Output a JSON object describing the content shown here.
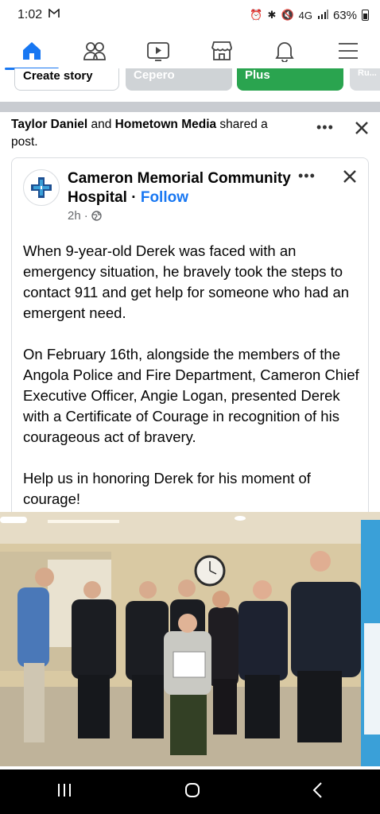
{
  "status_bar": {
    "time": "1:02",
    "left_icon": "gmail-m-icon",
    "network": "4G",
    "battery_pct": "63%"
  },
  "nav": {
    "items": [
      {
        "name": "home",
        "icon": "home-icon",
        "active": true
      },
      {
        "name": "friends",
        "icon": "friends-icon"
      },
      {
        "name": "watch",
        "icon": "video-icon"
      },
      {
        "name": "marketplace",
        "icon": "store-icon"
      },
      {
        "name": "notifications",
        "icon": "bell-icon"
      },
      {
        "name": "menu",
        "icon": "hamburger-icon"
      }
    ]
  },
  "stories": {
    "create_label": "Create story",
    "story2_label": "Cepero",
    "story3_label": "Plus",
    "story4_label": "Ru..."
  },
  "share_header": {
    "user1": "Taylor Daniel",
    "conj": " and ",
    "user2": "Hometown Media",
    "rest": " shared a post."
  },
  "post": {
    "page_name": "Cameron Memorial Community Hospital",
    "separator": " · ",
    "follow_label": "Follow",
    "time": "2h",
    "dot": "·",
    "paragraphs": [
      "When 9-year-old Derek was faced with an emergency situation, he bravely took the steps to contact 911 and get help for someone who had an emergent need.",
      "On February 16th, alongside the members of the Angola Police and Fire Department, Cameron Chief Executive Officer, Angie Logan, presented Derek with a Certificate of Courage in recognition of his courageous act of bravery.",
      "Help us in honoring Derek for his moment of courage!"
    ]
  },
  "colors": {
    "accent": "#1877f2",
    "muted": "#65676b",
    "divider": "#c9ccd1"
  }
}
